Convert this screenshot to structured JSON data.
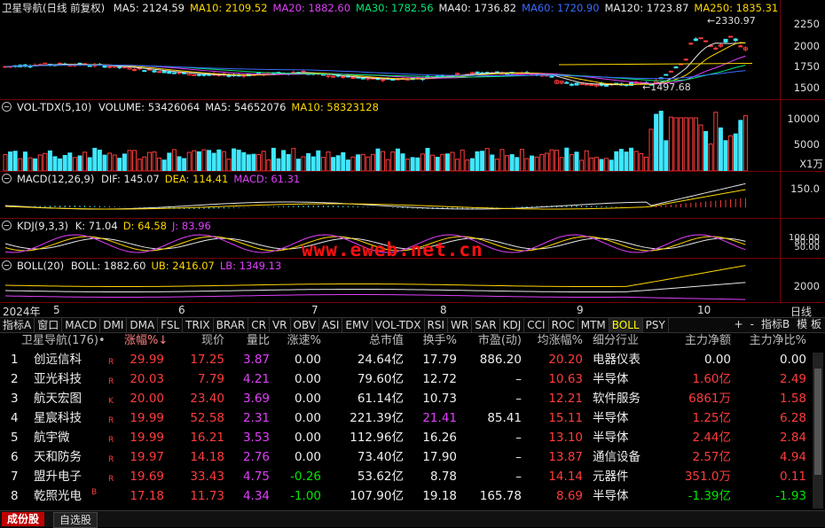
{
  "kline": {
    "title": "卫星导航(日线 前复权)",
    "ma": [
      {
        "label": "MA5: 2124.59",
        "color": "#e6e6e6"
      },
      {
        "label": "MA10: 2109.52",
        "color": "#ffd700"
      },
      {
        "label": "MA20: 1882.60",
        "color": "#e040fb"
      },
      {
        "label": "MA30: 1782.56",
        "color": "#00e676"
      },
      {
        "label": "MA40: 1736.82",
        "color": "#e6e6e6"
      },
      {
        "label": "MA60: 1720.90",
        "color": "#3b6cff"
      },
      {
        "label": "MA120: 1723.87",
        "color": "#e6e6e6"
      },
      {
        "label": "MA250: 1835.31",
        "color": "#ffd700"
      }
    ],
    "yticks": [
      "2250",
      "2000",
      "1750",
      "1500"
    ],
    "high_label": "2330.97",
    "low_label": "1497.68"
  },
  "volume": {
    "title": "VOL-TDX(5,10)",
    "items": [
      {
        "label": "VOLUME: 53426064",
        "color": "#e6e6e6"
      },
      {
        "label": "MA5: 54652076",
        "color": "#e6e6e6"
      },
      {
        "label": "MA10: 58323128",
        "color": "#ffd700"
      }
    ],
    "yticks": [
      "10000",
      "5000"
    ],
    "unit": "X1万"
  },
  "macd": {
    "title": "MACD(12,26,9)",
    "items": [
      {
        "label": "DIF: 145.07",
        "color": "#e6e6e6"
      },
      {
        "label": "DEA: 114.41",
        "color": "#ffd700"
      },
      {
        "label": "MACD: 61.31",
        "color": "#e040fb"
      }
    ],
    "yticks": [
      "150.0"
    ]
  },
  "kdj": {
    "title": "KDJ(9,3,3)",
    "items": [
      {
        "label": "K: 71.04",
        "color": "#e6e6e6"
      },
      {
        "label": "D: 64.58",
        "color": "#ffd700"
      },
      {
        "label": "J: 83.96",
        "color": "#e040fb"
      }
    ],
    "yticks": [
      "100.00",
      "80.00",
      "50.00"
    ]
  },
  "boll": {
    "title": "BOLL(20)",
    "items": [
      {
        "label": "BOLL: 1882.60",
        "color": "#e6e6e6"
      },
      {
        "label": "UB: 2416.07",
        "color": "#ffd700"
      },
      {
        "label": "LB: 1349.13",
        "color": "#e040fb"
      }
    ],
    "yticks": [
      "2000"
    ]
  },
  "dateaxis": {
    "year": "2024年",
    "months": [
      "5",
      "6",
      "7",
      "8",
      "9",
      "10"
    ],
    "period": "日线"
  },
  "watermark": "www.eweb.net.cn",
  "indicator_tabs": [
    "指标A",
    "窗口",
    "MACD",
    "DMI",
    "DMA",
    "FSL",
    "TRIX",
    "BRAR",
    "CR",
    "VR",
    "OBV",
    "ASI",
    "EMV",
    "VOL-TDX",
    "RSI",
    "WR",
    "SAR",
    "KDJ",
    "CCI",
    "ROC",
    "MTM",
    "BOLL",
    "PSY"
  ],
  "active_tab": "BOLL",
  "right_tabs": [
    "+",
    "-",
    "指标B",
    "模 板"
  ],
  "table": {
    "headers": [
      "卫星导航(176)•",
      "涨幅%↓",
      "现价",
      "量比",
      "涨速%",
      "总市值",
      "换手%",
      "市盈(动)",
      "均涨幅%",
      "细分行业",
      "主力净额",
      "主力净比%"
    ],
    "rows": [
      {
        "no": "1",
        "name": "创远信科",
        "flag": "R",
        "chg": "29.99",
        "price": "17.25",
        "vr": "3.87",
        "speed": "0.00",
        "cap": "24.64亿",
        "turn": "17.79",
        "pe": "886.20",
        "avg": "20.20",
        "ind": "电器仪表",
        "net": "0.00",
        "ratio": "0.00"
      },
      {
        "no": "2",
        "name": "亚光科技",
        "flag": "R",
        "chg": "20.03",
        "price": "7.79",
        "vr": "4.21",
        "speed": "0.00",
        "cap": "79.60亿",
        "turn": "12.72",
        "pe": "–",
        "avg": "10.63",
        "ind": "半导体",
        "net": "1.60亿",
        "ratio": "2.49"
      },
      {
        "no": "3",
        "name": "航天宏图",
        "flag": "K",
        "chg": "20.00",
        "price": "23.40",
        "vr": "3.69",
        "speed": "0.00",
        "cap": "61.14亿",
        "turn": "10.73",
        "pe": "–",
        "avg": "12.21",
        "ind": "软件服务",
        "net": "6861万",
        "ratio": "1.58"
      },
      {
        "no": "4",
        "name": "星宸科技",
        "flag": "R",
        "chg": "19.99",
        "price": "52.58",
        "vr": "2.31",
        "speed": "0.00",
        "cap": "221.39亿",
        "turn": "21.41",
        "pe": "85.41",
        "avg": "15.11",
        "ind": "半导体",
        "net": "1.25亿",
        "ratio": "6.28"
      },
      {
        "no": "5",
        "name": "航宇微",
        "flag": "R",
        "chg": "19.99",
        "price": "16.21",
        "vr": "3.53",
        "speed": "0.00",
        "cap": "112.96亿",
        "turn": "16.26",
        "pe": "–",
        "avg": "13.10",
        "ind": "半导体",
        "net": "2.44亿",
        "ratio": "2.84"
      },
      {
        "no": "6",
        "name": "天和防务",
        "flag": "R",
        "chg": "19.97",
        "price": "14.18",
        "vr": "2.76",
        "speed": "0.00",
        "cap": "73.40亿",
        "turn": "17.90",
        "pe": "–",
        "avg": "13.87",
        "ind": "通信设备",
        "net": "2.57亿",
        "ratio": "4.94"
      },
      {
        "no": "7",
        "name": "盟升电子",
        "flag": "R",
        "chg": "19.69",
        "price": "33.43",
        "vr": "4.75",
        "speed": "-0.26",
        "cap": "53.62亿",
        "turn": "8.78",
        "pe": "–",
        "avg": "14.14",
        "ind": "元器件",
        "net": "351.0万",
        "ratio": "0.11"
      },
      {
        "no": "8",
        "name": "乾照光电",
        "flag": "B",
        "chg": "17.18",
        "price": "11.73",
        "vr": "4.34",
        "speed": "-1.00",
        "cap": "107.90亿",
        "turn": "19.18",
        "pe": "165.78",
        "avg": "8.69",
        "ind": "半导体",
        "net": "-1.39亿",
        "ratio": "-1.93"
      }
    ]
  },
  "bottom_tabs": [
    "成份股",
    "自选股"
  ]
}
